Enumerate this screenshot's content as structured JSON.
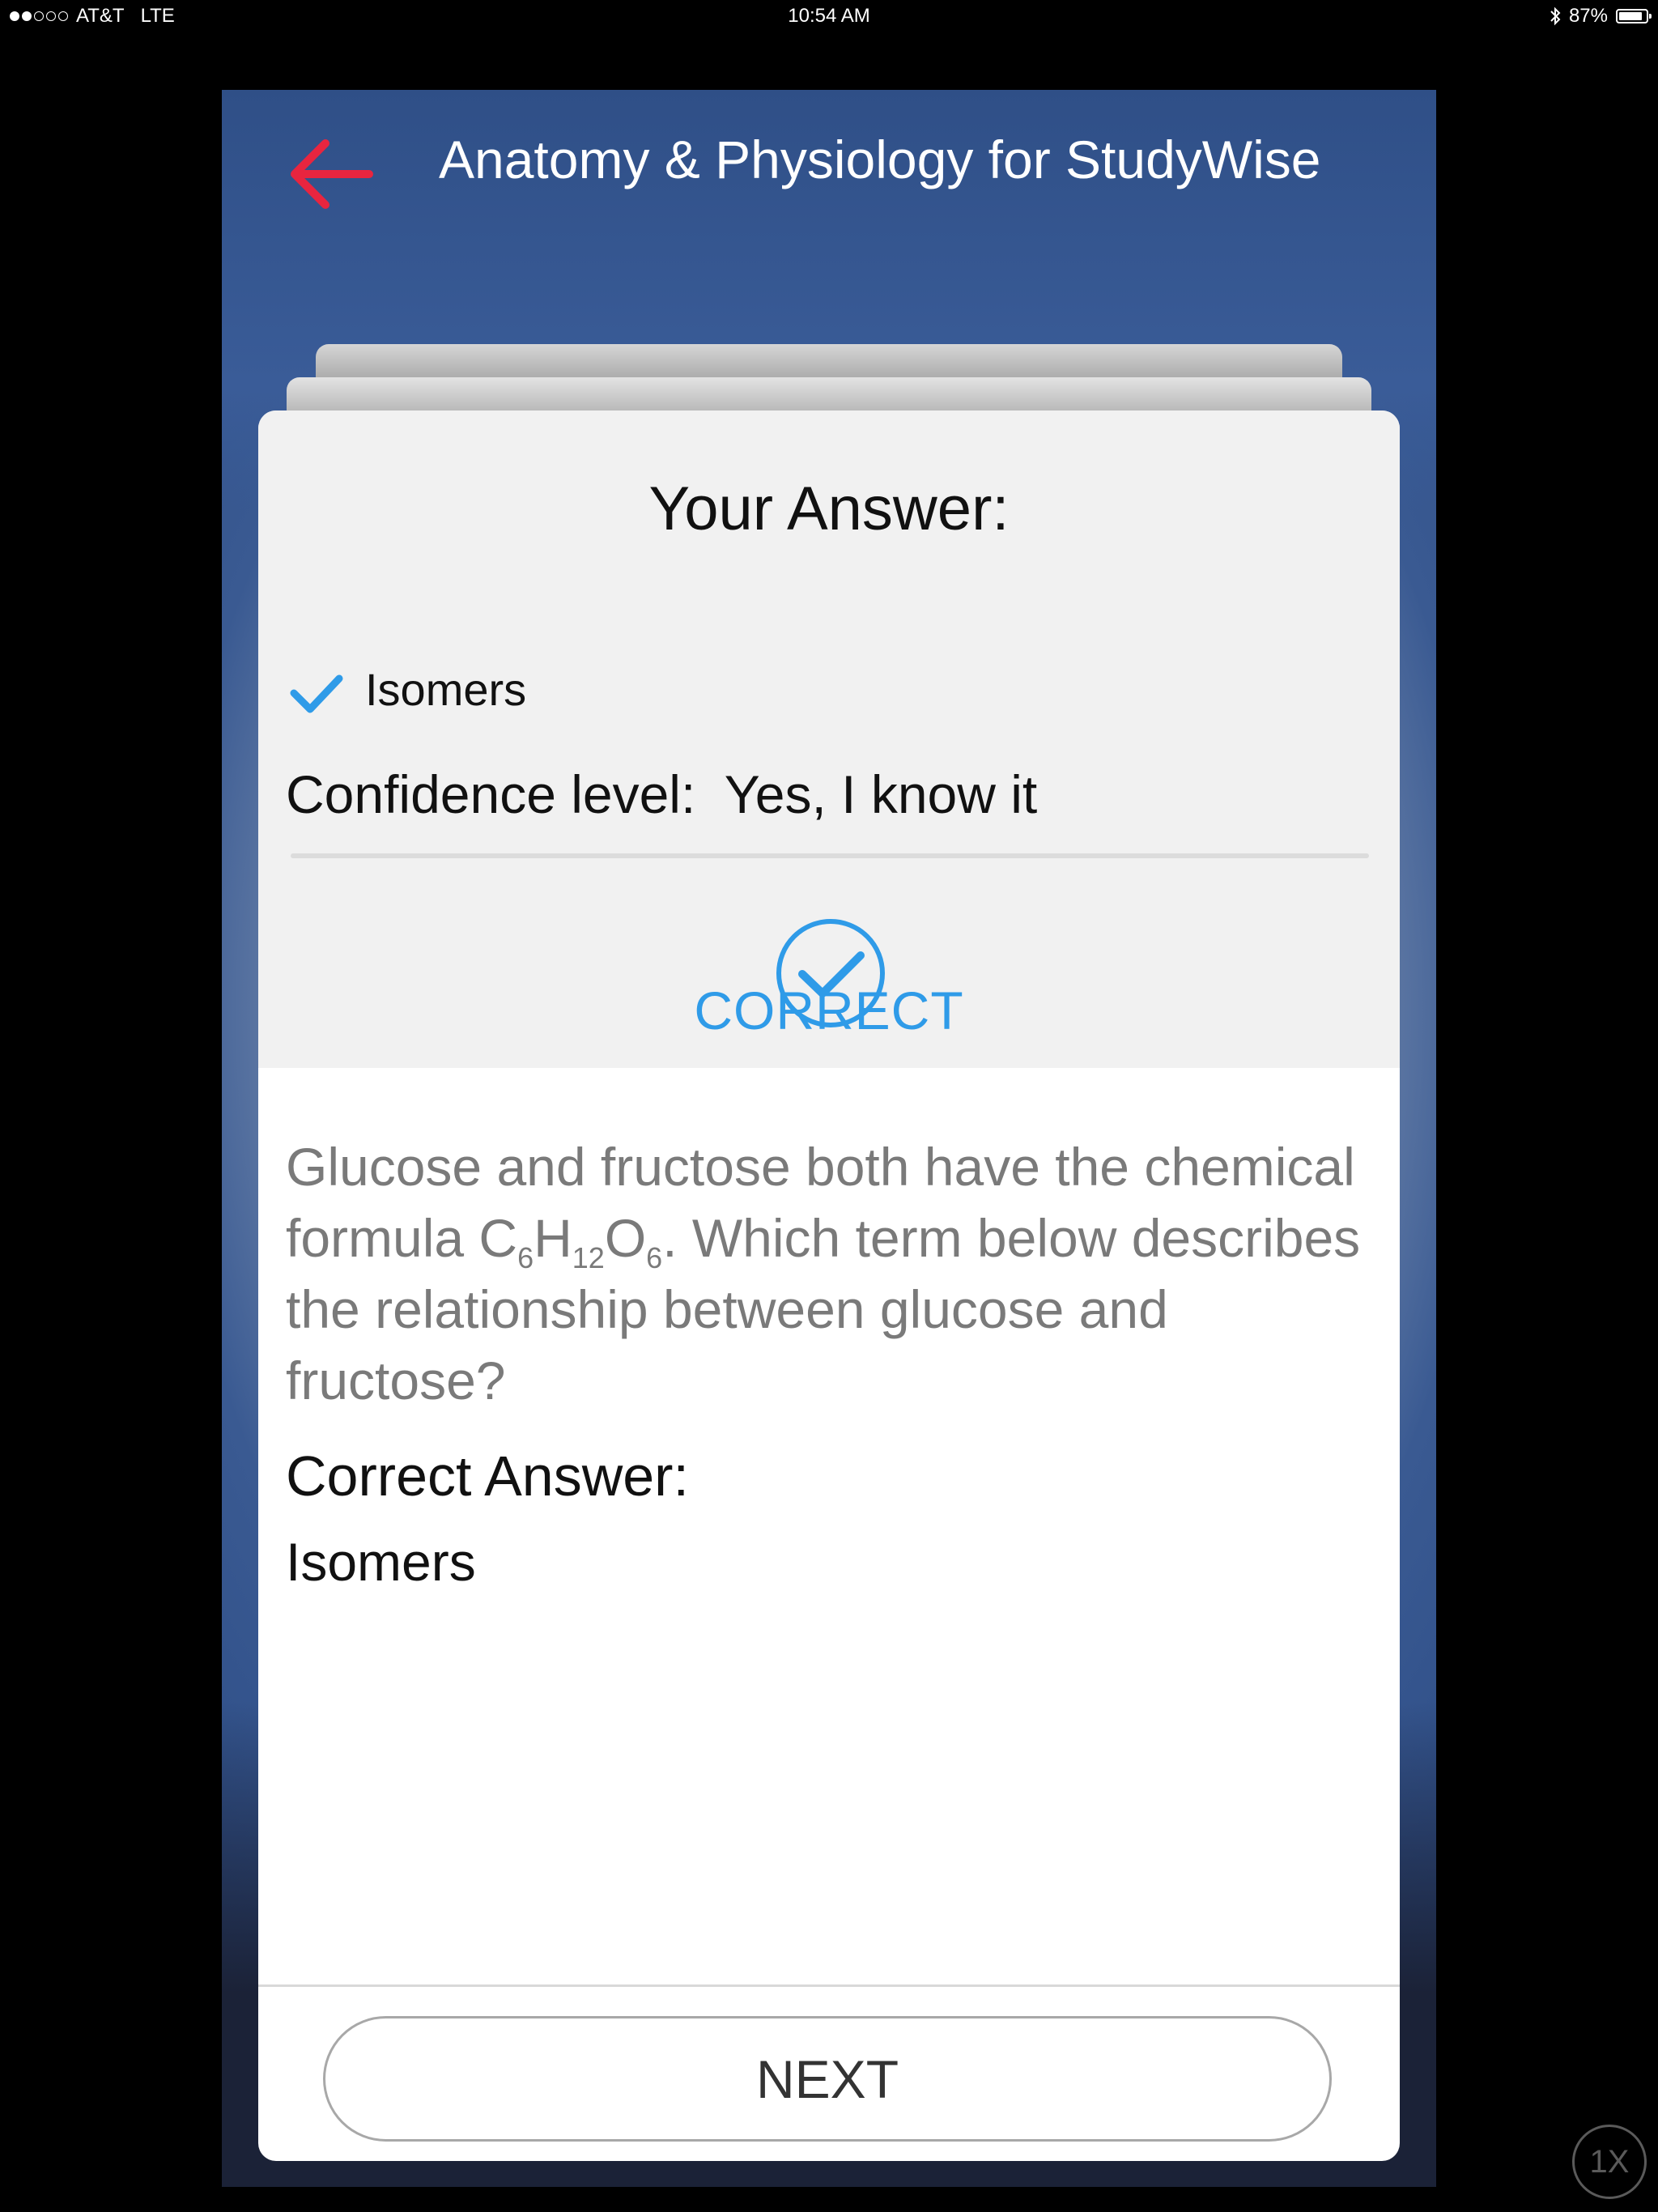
{
  "status_bar": {
    "carrier": "AT&T",
    "network": "LTE",
    "time": "10:54 AM",
    "battery": "87%",
    "battery_level": 0.87,
    "signal_bars_filled": 2,
    "signal_bars_total": 5
  },
  "header": {
    "title": "Anatomy & Physiology for StudyWise",
    "back_icon": "back-arrow-icon",
    "accent_color": "#e8253f"
  },
  "your_answer": {
    "title": "Your Answer:",
    "selected_option": "Isomers",
    "confidence_label": "Confidence level:",
    "confidence_value": "Yes, I know it"
  },
  "result": {
    "label": "CORRECT",
    "icon": "check-circle-icon",
    "color": "#2f9be8"
  },
  "question": {
    "before": "Glucose and fructose both have the chemical formula C",
    "c_sub": "6",
    "h": "H",
    "h_sub": "12",
    "o": "O",
    "o_sub": "6",
    "after": ". Which term below describes the relationship between glucose and fructose?"
  },
  "correct_answer": {
    "title": "Correct Answer:",
    "value": "Isomers"
  },
  "footer": {
    "next_label": "NEXT"
  },
  "zoom_badge": "1X"
}
